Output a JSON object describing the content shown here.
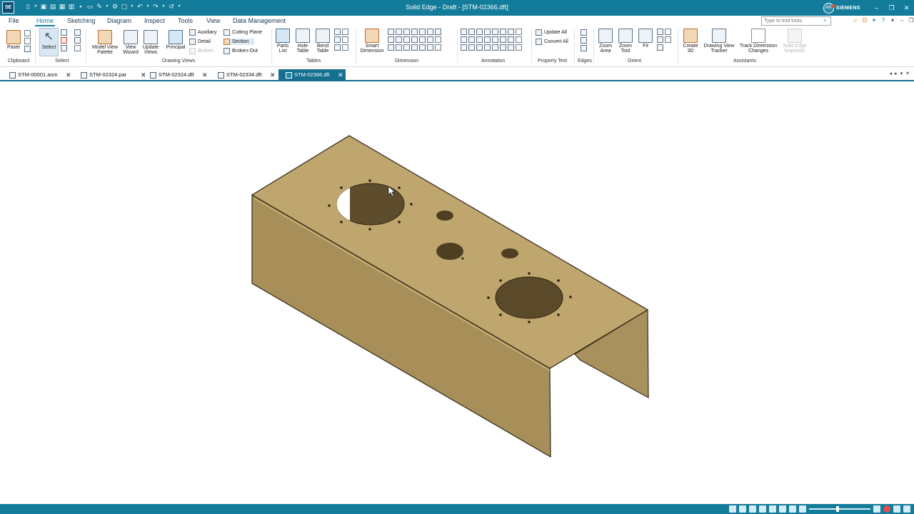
{
  "titlebar": {
    "app_logo": "SE",
    "title": "Solid Edge - Draft - [STM-02366.dft]",
    "user_initials": "AN",
    "brand": "SIEMENS"
  },
  "menu": {
    "tabs": [
      "File",
      "Home",
      "Sketching",
      "Diagram",
      "Inspect",
      "Tools",
      "View",
      "Data Management"
    ],
    "active_tab": "Home",
    "search_placeholder": "Type to find tools"
  },
  "ribbon": {
    "groups": {
      "clipboard": "Clipboard",
      "select": "Select",
      "drawing_views": "Drawing Views",
      "tables": "Tables",
      "dimension": "Dimension",
      "annotation": "Annotation",
      "property_text": "Property Text",
      "edges": "Edges",
      "orient": "Orient",
      "assistants": "Assistants"
    },
    "buttons": {
      "paste": "Paste",
      "select": "Select",
      "model_view_palette_1": "Model View",
      "model_view_palette_2": "Palette",
      "view_wizard_1": "View",
      "view_wizard_2": "Wizard",
      "update_views_1": "Update",
      "update_views_2": "Views",
      "principal": "Principal",
      "auxiliary": "Auxiliary",
      "detail": "Detail",
      "broken": "Broken",
      "cutting_plane": "Cutting Plane",
      "section": "Section",
      "broken_out": "Broken-Out",
      "parts_list_1": "Parts",
      "parts_list_2": "List",
      "hole_table_1": "Hole",
      "hole_table_2": "Table",
      "bend_table_1": "Bend",
      "bend_table_2": "Table",
      "smart_dimension_1": "Smart",
      "smart_dimension_2": "Dimension",
      "update_all": "Update All",
      "convert_all": "Convert All",
      "zoom_area_1": "Zoom",
      "zoom_area_2": "Area",
      "zoom_tool_1": "Zoom",
      "zoom_tool_2": "Tool",
      "fit": "Fit",
      "create_3d_1": "Create",
      "create_3d_2": "3D",
      "drawing_view_tracker_1": "Drawing View",
      "drawing_view_tracker_2": "Tracker",
      "track_dimension_changes_1": "Track Dimension",
      "track_dimension_changes_2": "Changes",
      "solid_edge_inspector_1": "Solid Edge",
      "solid_edge_inspector_2": "Inspector"
    }
  },
  "documents": {
    "tabs": [
      "STM-00001.asm",
      "STM-02324.par",
      "STM-02324.dft",
      "STM-02334.dft",
      "STM-02366.dft"
    ],
    "active": "STM-02366.dft"
  },
  "colors": {
    "title_bar": "#137c9b",
    "accent": "#1a7da0",
    "part_top": "#bea36c",
    "part_side": "#a48b56"
  },
  "icons": [
    "app-logo-icon",
    "new-file-icon",
    "open-icon",
    "save-icon",
    "undo-icon",
    "redo-icon",
    "search-icon",
    "help-icon",
    "close-icon",
    "minimize-icon",
    "maximize-icon",
    "mouse-cursor-icon"
  ]
}
